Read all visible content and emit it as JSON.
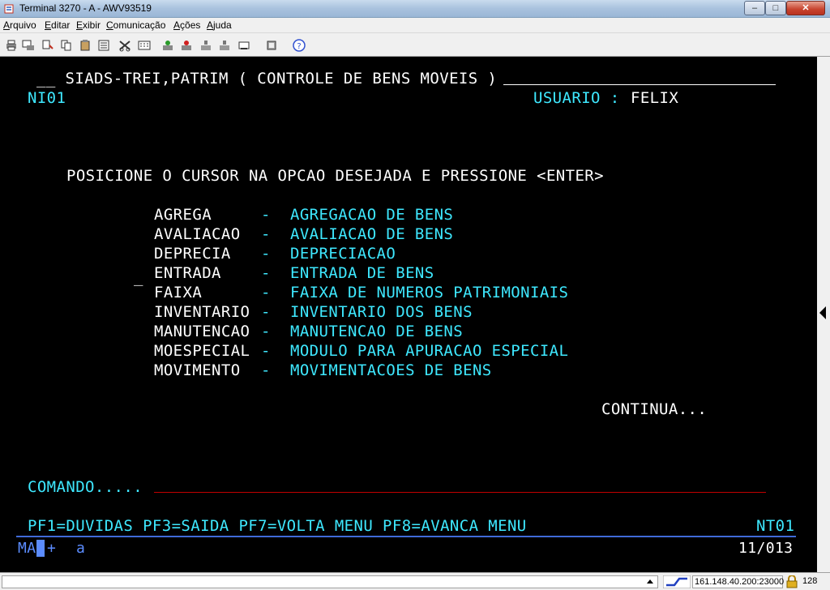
{
  "window": {
    "title": "Terminal 3270 - A - AWV93519",
    "minimize_label": "–",
    "maximize_label": "□",
    "close_label": "✕"
  },
  "menu": [
    "Arquivo",
    "Editar",
    "Exibir",
    "Comunicação",
    "Ações",
    "Ajuda"
  ],
  "toolbar_icons": [
    "print-icon",
    "print-screen-icon",
    "copy-icon",
    "paste-icon",
    "cut-icon",
    "macro-icon",
    "keypad-icon",
    "connect-icon",
    "disconnect-icon",
    "stop-icon",
    "send-icon",
    "receive-icon",
    "transfer-icon",
    "help-icon"
  ],
  "screen": {
    "header": "__ SIADS-TREI,PATRIM ( CONTROLE DE BENS MOVEIS )",
    "screen_id": "NI01",
    "user_label": "USUARIO :",
    "user_value": "FELIX",
    "instruction": "POSICIONE O CURSOR NA OPCAO DESEJADA E PRESSIONE <ENTER>",
    "cursor_marker": "_",
    "options": [
      {
        "code": "AGREGA",
        "sep": "-",
        "desc": "AGREGACAO DE BENS"
      },
      {
        "code": "AVALIACAO",
        "sep": "-",
        "desc": "AVALIACAO DE BENS"
      },
      {
        "code": "DEPRECIA",
        "sep": "-",
        "desc": "DEPRECIACAO"
      },
      {
        "code": "ENTRADA",
        "sep": "-",
        "desc": "ENTRADA DE BENS"
      },
      {
        "code": "FAIXA",
        "sep": "-",
        "desc": "FAIXA DE NUMEROS PATRIMONIAIS"
      },
      {
        "code": "INVENTARIO",
        "sep": "-",
        "desc": "INVENTARIO DOS BENS"
      },
      {
        "code": "MANUTENCAO",
        "sep": "-",
        "desc": "MANUTENCAO DE BENS"
      },
      {
        "code": "MOESPECIAL",
        "sep": "-",
        "desc": "MODULO PARA APURACAO ESPECIAL"
      },
      {
        "code": "MOVIMENTO",
        "sep": "-",
        "desc": "MOVIMENTACOES DE BENS"
      }
    ],
    "continua": "CONTINUA...",
    "command_label": "COMANDO.....",
    "pf_keys": "PF1=DUVIDAS PF3=SAIDA PF7=VOLTA MENU PF8=AVANCA MENU",
    "pf_screen_id": "NT01"
  },
  "oia": {
    "mode": "MA",
    "plus": "+",
    "a": "a",
    "cursor_pos": "11/013"
  },
  "statusbar": {
    "host": "161.148.40.200:23000",
    "bits": "128"
  }
}
